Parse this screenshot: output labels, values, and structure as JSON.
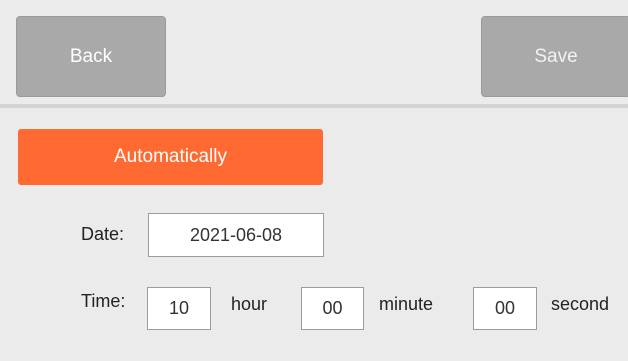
{
  "toolbar": {
    "back_label": "Back",
    "save_label": "Save"
  },
  "mode": {
    "auto_label": "Automatically",
    "accent_color": "#ff6a33"
  },
  "date": {
    "label": "Date:",
    "value": "2021-06-08"
  },
  "time": {
    "label": "Time:",
    "hour_value": "10",
    "hour_unit": "hour",
    "minute_value": "00",
    "minute_unit": "minute",
    "second_value": "00",
    "second_unit": "second"
  }
}
